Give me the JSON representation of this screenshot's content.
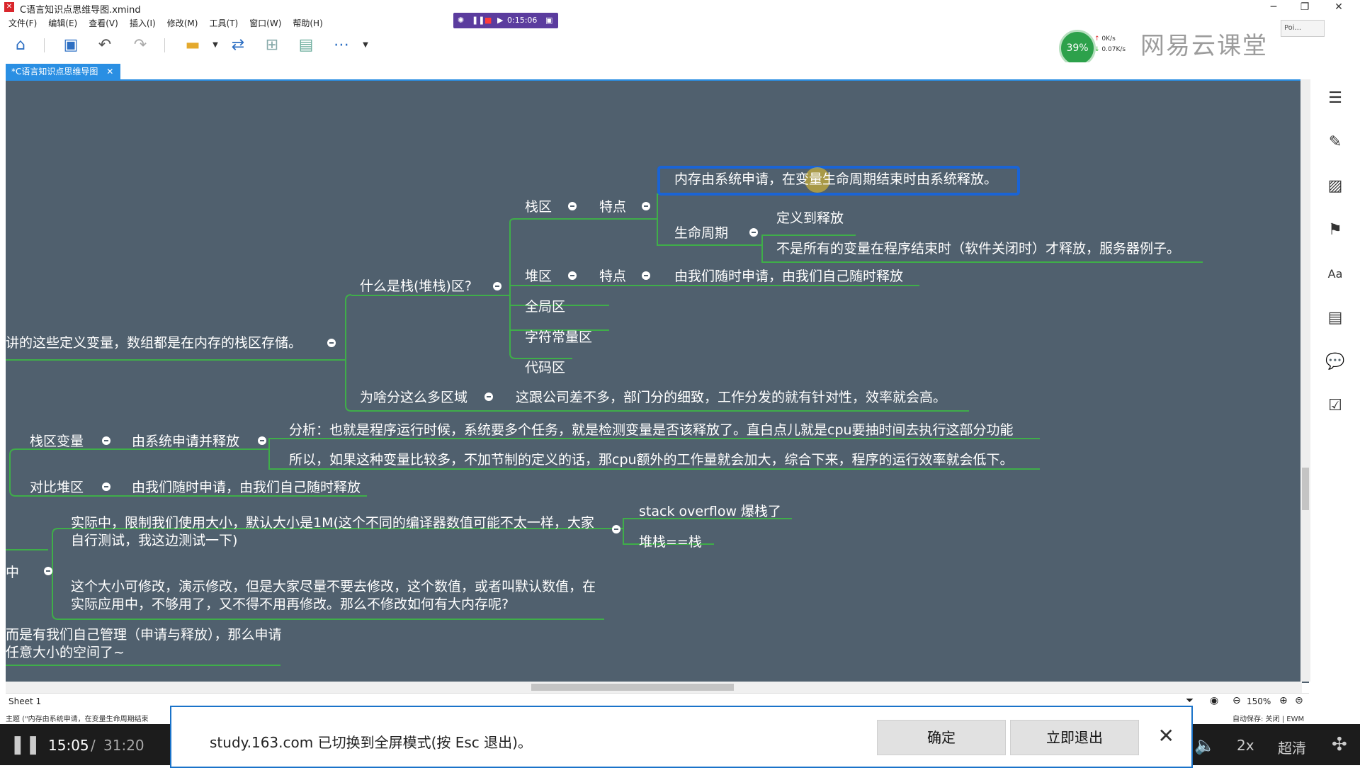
{
  "window": {
    "title": "C语言知识点思维导图.xmind",
    "app_icon": "xmind-icon"
  },
  "menu": [
    "文件(F)",
    "编辑(E)",
    "查看(V)",
    "插入(I)",
    "修改(M)",
    "工具(T)",
    "窗口(W)",
    "帮助(H)"
  ],
  "recorder": {
    "time": "0:15:06"
  },
  "network": {
    "percent": "39%",
    "up": "0K/s",
    "down": "0.07K/s"
  },
  "watermark": "网易云课堂",
  "corner_box": "Poi...",
  "tab": {
    "label": "*C语言知识点思维导图"
  },
  "mindmap": {
    "t_memory_claim": "内存由系统申请，在变量生命周期结束时由系统释放。",
    "t_stack": "栈区",
    "t_feature1": "特点",
    "t_lifecycle": "生命周期",
    "t_def_release": "定义到释放",
    "t_not_all": "不是所有的变量在程序结束时（软件关闭时）才释放，服务器例子。",
    "t_heap": "堆区",
    "t_feature2": "特点",
    "t_heap_desc": "由我们随时申请，由我们自己随时释放",
    "t_what_stack": "什么是栈(堆栈)区?",
    "t_global": "全局区",
    "t_string_const": "字符常量区",
    "t_code": "代码区",
    "t_root_left": "讲的这些定义变量，数组都是在内存的栈区存储。",
    "t_why_regions": "为啥分这么多区域",
    "t_company": "这跟公司差不多，部门分的细致，工作分发的就有针对性，效率就会高。",
    "t_analysis": "分析：也就是程序运行时候，系统要多个任务，就是检测变量是否该释放了。直白点儿就是cpu要抽时间去执行这部分功能",
    "t_therefore": "所以，如果这种变量比较多，不加节制的定义的话，那cpu额外的工作量就会加大，综合下来，程序的运行效率就会低下。",
    "t_stack_var": "栈区变量",
    "t_sys_apply": "由系统申请并释放",
    "t_compare_heap": "对比堆区",
    "t_heap_desc2": "由我们随时申请，由我们自己随时释放",
    "t_actual": "实际中，限制我们使用大小，默认大小是1M(这个不同的编译器数值可能不太一样，大家自行测试，我这边测试一下)",
    "t_overflow": "stack overflow 爆栈了",
    "t_heapstack": "堆栈==栈",
    "t_mid": "中",
    "t_modify": "这个大小可修改，演示修改，但是大家尽量不要去修改，这个数值，或者叫默认数值，在实际应用中，不够用了，又不得不用再修改。那么不修改如何有大内存呢?",
    "t_self_manage": "而是有我们自己管理（申请与释放），那么申请任意大小的空间了~"
  },
  "sheet": {
    "name": "Sheet 1",
    "zoom": "150%"
  },
  "status": {
    "left": "主题 (\"内存由系统申请，在变量生命周期结束",
    "right": "自动保存: 关闭 | EWM"
  },
  "notify": {
    "text": "study.163.com 已切换到全屏模式(按 Esc 退出)。",
    "confirm": "确定",
    "exit": "立即退出"
  },
  "video": {
    "current": "15:05",
    "sep": "/",
    "total": "31:20",
    "speed": "2x",
    "quality": "超清"
  },
  "colors": {
    "canvas": "#50606e",
    "branch": "#3fae49",
    "selected": "#1a64d6",
    "accent": "#2a8fe3"
  }
}
